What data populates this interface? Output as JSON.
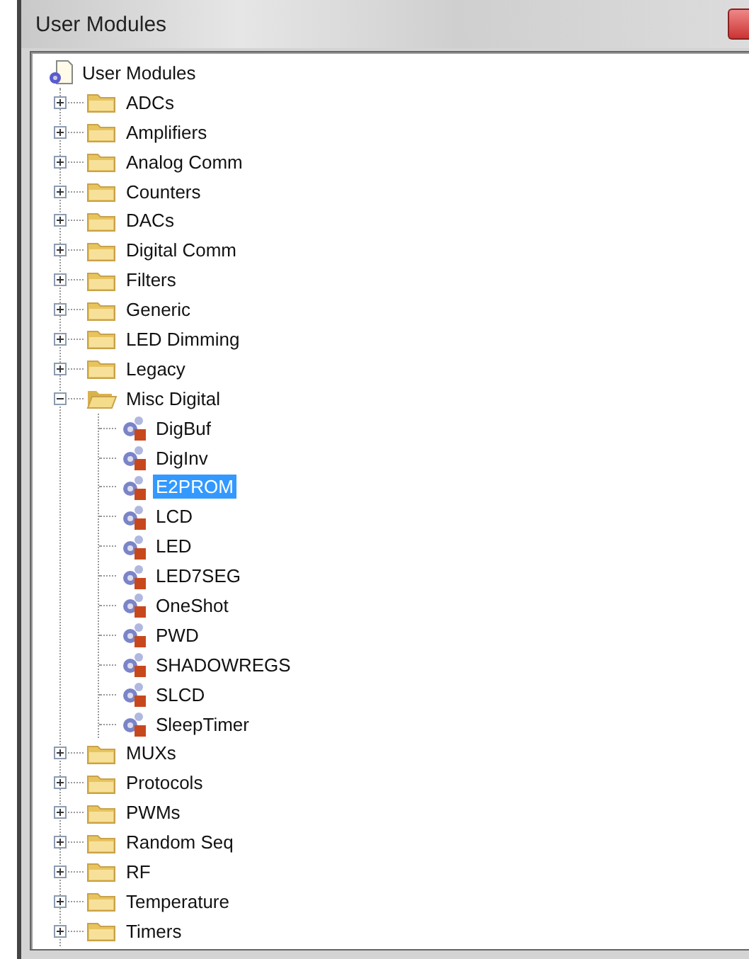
{
  "window": {
    "title": "User Modules"
  },
  "tree": {
    "label": "User Modules",
    "kind": "root",
    "selected": false,
    "children": [
      {
        "label": "ADCs",
        "kind": "folder",
        "selected": false,
        "expanded": false
      },
      {
        "label": "Amplifiers",
        "kind": "folder",
        "selected": false,
        "expanded": false
      },
      {
        "label": "Analog Comm",
        "kind": "folder",
        "selected": false,
        "expanded": false
      },
      {
        "label": "Counters",
        "kind": "folder",
        "selected": false,
        "expanded": false
      },
      {
        "label": "DACs",
        "kind": "folder",
        "selected": false,
        "expanded": false
      },
      {
        "label": "Digital Comm",
        "kind": "folder",
        "selected": false,
        "expanded": false
      },
      {
        "label": "Filters",
        "kind": "folder",
        "selected": false,
        "expanded": false
      },
      {
        "label": "Generic",
        "kind": "folder",
        "selected": false,
        "expanded": false
      },
      {
        "label": "LED Dimming",
        "kind": "folder",
        "selected": false,
        "expanded": false
      },
      {
        "label": "Legacy",
        "kind": "folder",
        "selected": false,
        "expanded": false
      },
      {
        "label": "Misc Digital",
        "kind": "folder",
        "selected": false,
        "expanded": true,
        "children": [
          {
            "label": "DigBuf",
            "kind": "module",
            "selected": false
          },
          {
            "label": "DigInv",
            "kind": "module",
            "selected": false
          },
          {
            "label": "E2PROM",
            "kind": "module",
            "selected": true
          },
          {
            "label": "LCD",
            "kind": "module",
            "selected": false
          },
          {
            "label": "LED",
            "kind": "module",
            "selected": false
          },
          {
            "label": "LED7SEG",
            "kind": "module",
            "selected": false
          },
          {
            "label": "OneShot",
            "kind": "module",
            "selected": false
          },
          {
            "label": "PWD",
            "kind": "module",
            "selected": false
          },
          {
            "label": "SHADOWREGS",
            "kind": "module",
            "selected": false
          },
          {
            "label": "SLCD",
            "kind": "module",
            "selected": false
          },
          {
            "label": "SleepTimer",
            "kind": "module",
            "selected": false
          }
        ]
      },
      {
        "label": "MUXs",
        "kind": "folder",
        "selected": false,
        "expanded": false
      },
      {
        "label": "Protocols",
        "kind": "folder",
        "selected": false,
        "expanded": false
      },
      {
        "label": "PWMs",
        "kind": "folder",
        "selected": false,
        "expanded": false
      },
      {
        "label": "Random Seq",
        "kind": "folder",
        "selected": false,
        "expanded": false
      },
      {
        "label": "RF",
        "kind": "folder",
        "selected": false,
        "expanded": false
      },
      {
        "label": "Temperature",
        "kind": "folder",
        "selected": false,
        "expanded": false
      },
      {
        "label": "Timers",
        "kind": "folder",
        "selected": false,
        "expanded": false
      }
    ]
  }
}
